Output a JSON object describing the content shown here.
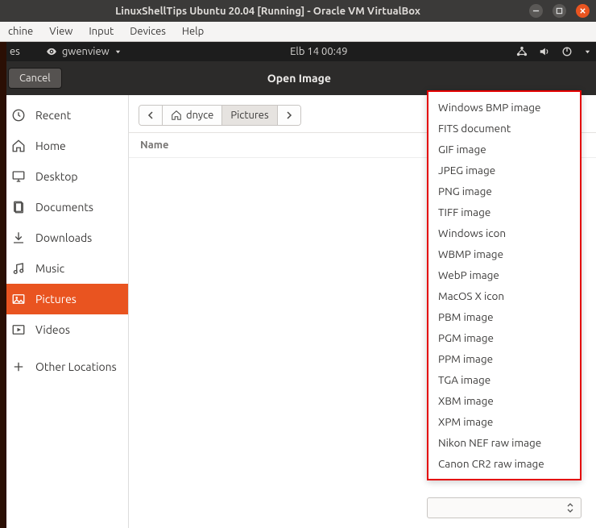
{
  "vbox": {
    "title": "LinuxShellTips Ubuntu 20.04 [Running] - Oracle VM VirtualBox",
    "menu": [
      "chine",
      "View",
      "Input",
      "Devices",
      "Help"
    ]
  },
  "panel": {
    "app_name": "gwenview",
    "clock": "Elb 14  00:49"
  },
  "header": {
    "cancel": "Cancel",
    "title": "Open Image"
  },
  "sidebar": {
    "items": [
      {
        "label": "Recent",
        "icon": "clock"
      },
      {
        "label": "Home",
        "icon": "home"
      },
      {
        "label": "Desktop",
        "icon": "desktop"
      },
      {
        "label": "Documents",
        "icon": "documents"
      },
      {
        "label": "Downloads",
        "icon": "downloads"
      },
      {
        "label": "Music",
        "icon": "music"
      },
      {
        "label": "Pictures",
        "icon": "pictures",
        "selected": true
      },
      {
        "label": "Videos",
        "icon": "videos"
      },
      {
        "label": "Other Locations",
        "icon": "plus"
      }
    ]
  },
  "breadcrumb": {
    "home_folder": "dnyce",
    "current": "Pictures"
  },
  "columns": {
    "name": "Name"
  },
  "filters": [
    "Windows BMP image",
    "FITS document",
    "GIF image",
    "JPEG image",
    "PNG image",
    "TIFF image",
    "Windows icon",
    "WBMP image",
    "WebP image",
    "MacOS X icon",
    "PBM image",
    "PGM image",
    "PPM image",
    "TGA image",
    "XBM image",
    "XPM image",
    "Nikon NEF raw image",
    "Canon CR2 raw image"
  ]
}
